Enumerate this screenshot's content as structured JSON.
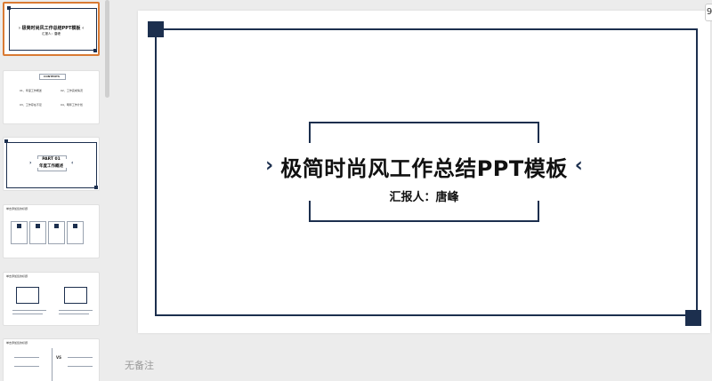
{
  "slide": {
    "title": "极简时尚风工作总结PPT模板",
    "reporter": "汇报人：唐峰",
    "chevron_left": "›",
    "chevron_right": "‹",
    "colors": {
      "frame": "#1c2f4e",
      "text": "#111111"
    }
  },
  "thumbnails": {
    "t1": {
      "title": "› 极简时尚风工作总结PPT模板 ‹",
      "sub": "汇报人：唐峰"
    },
    "t2": {
      "header": "CONTENTS",
      "items": [
        "01、年度工作概述",
        "02、工作完成情况",
        "03、工作存在不足",
        "04、明年工作计划"
      ]
    },
    "t3": {
      "part": "PART 01",
      "name": "年度工作概述"
    },
    "t4": {
      "header": "单击添加您的标题"
    },
    "t5": {
      "header": "单击添加您的标题"
    },
    "t6": {
      "header": "单击添加您的标题",
      "center": "VS"
    }
  },
  "notes_placeholder": "无备注",
  "edge_button": "9"
}
